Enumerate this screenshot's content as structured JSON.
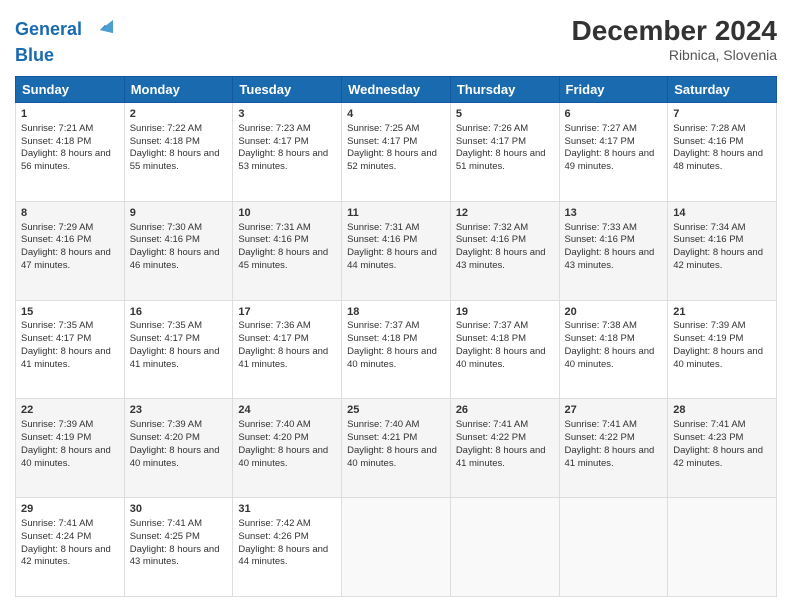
{
  "header": {
    "logo_line1": "General",
    "logo_line2": "Blue",
    "title": "December 2024",
    "subtitle": "Ribnica, Slovenia"
  },
  "days_of_week": [
    "Sunday",
    "Monday",
    "Tuesday",
    "Wednesday",
    "Thursday",
    "Friday",
    "Saturday"
  ],
  "weeks": [
    [
      {
        "day": "1",
        "sunrise": "Sunrise: 7:21 AM",
        "sunset": "Sunset: 4:18 PM",
        "daylight": "Daylight: 8 hours and 56 minutes."
      },
      {
        "day": "2",
        "sunrise": "Sunrise: 7:22 AM",
        "sunset": "Sunset: 4:18 PM",
        "daylight": "Daylight: 8 hours and 55 minutes."
      },
      {
        "day": "3",
        "sunrise": "Sunrise: 7:23 AM",
        "sunset": "Sunset: 4:17 PM",
        "daylight": "Daylight: 8 hours and 53 minutes."
      },
      {
        "day": "4",
        "sunrise": "Sunrise: 7:25 AM",
        "sunset": "Sunset: 4:17 PM",
        "daylight": "Daylight: 8 hours and 52 minutes."
      },
      {
        "day": "5",
        "sunrise": "Sunrise: 7:26 AM",
        "sunset": "Sunset: 4:17 PM",
        "daylight": "Daylight: 8 hours and 51 minutes."
      },
      {
        "day": "6",
        "sunrise": "Sunrise: 7:27 AM",
        "sunset": "Sunset: 4:17 PM",
        "daylight": "Daylight: 8 hours and 49 minutes."
      },
      {
        "day": "7",
        "sunrise": "Sunrise: 7:28 AM",
        "sunset": "Sunset: 4:16 PM",
        "daylight": "Daylight: 8 hours and 48 minutes."
      }
    ],
    [
      {
        "day": "8",
        "sunrise": "Sunrise: 7:29 AM",
        "sunset": "Sunset: 4:16 PM",
        "daylight": "Daylight: 8 hours and 47 minutes."
      },
      {
        "day": "9",
        "sunrise": "Sunrise: 7:30 AM",
        "sunset": "Sunset: 4:16 PM",
        "daylight": "Daylight: 8 hours and 46 minutes."
      },
      {
        "day": "10",
        "sunrise": "Sunrise: 7:31 AM",
        "sunset": "Sunset: 4:16 PM",
        "daylight": "Daylight: 8 hours and 45 minutes."
      },
      {
        "day": "11",
        "sunrise": "Sunrise: 7:31 AM",
        "sunset": "Sunset: 4:16 PM",
        "daylight": "Daylight: 8 hours and 44 minutes."
      },
      {
        "day": "12",
        "sunrise": "Sunrise: 7:32 AM",
        "sunset": "Sunset: 4:16 PM",
        "daylight": "Daylight: 8 hours and 43 minutes."
      },
      {
        "day": "13",
        "sunrise": "Sunrise: 7:33 AM",
        "sunset": "Sunset: 4:16 PM",
        "daylight": "Daylight: 8 hours and 43 minutes."
      },
      {
        "day": "14",
        "sunrise": "Sunrise: 7:34 AM",
        "sunset": "Sunset: 4:16 PM",
        "daylight": "Daylight: 8 hours and 42 minutes."
      }
    ],
    [
      {
        "day": "15",
        "sunrise": "Sunrise: 7:35 AM",
        "sunset": "Sunset: 4:17 PM",
        "daylight": "Daylight: 8 hours and 41 minutes."
      },
      {
        "day": "16",
        "sunrise": "Sunrise: 7:35 AM",
        "sunset": "Sunset: 4:17 PM",
        "daylight": "Daylight: 8 hours and 41 minutes."
      },
      {
        "day": "17",
        "sunrise": "Sunrise: 7:36 AM",
        "sunset": "Sunset: 4:17 PM",
        "daylight": "Daylight: 8 hours and 41 minutes."
      },
      {
        "day": "18",
        "sunrise": "Sunrise: 7:37 AM",
        "sunset": "Sunset: 4:18 PM",
        "daylight": "Daylight: 8 hours and 40 minutes."
      },
      {
        "day": "19",
        "sunrise": "Sunrise: 7:37 AM",
        "sunset": "Sunset: 4:18 PM",
        "daylight": "Daylight: 8 hours and 40 minutes."
      },
      {
        "day": "20",
        "sunrise": "Sunrise: 7:38 AM",
        "sunset": "Sunset: 4:18 PM",
        "daylight": "Daylight: 8 hours and 40 minutes."
      },
      {
        "day": "21",
        "sunrise": "Sunrise: 7:39 AM",
        "sunset": "Sunset: 4:19 PM",
        "daylight": "Daylight: 8 hours and 40 minutes."
      }
    ],
    [
      {
        "day": "22",
        "sunrise": "Sunrise: 7:39 AM",
        "sunset": "Sunset: 4:19 PM",
        "daylight": "Daylight: 8 hours and 40 minutes."
      },
      {
        "day": "23",
        "sunrise": "Sunrise: 7:39 AM",
        "sunset": "Sunset: 4:20 PM",
        "daylight": "Daylight: 8 hours and 40 minutes."
      },
      {
        "day": "24",
        "sunrise": "Sunrise: 7:40 AM",
        "sunset": "Sunset: 4:20 PM",
        "daylight": "Daylight: 8 hours and 40 minutes."
      },
      {
        "day": "25",
        "sunrise": "Sunrise: 7:40 AM",
        "sunset": "Sunset: 4:21 PM",
        "daylight": "Daylight: 8 hours and 40 minutes."
      },
      {
        "day": "26",
        "sunrise": "Sunrise: 7:41 AM",
        "sunset": "Sunset: 4:22 PM",
        "daylight": "Daylight: 8 hours and 41 minutes."
      },
      {
        "day": "27",
        "sunrise": "Sunrise: 7:41 AM",
        "sunset": "Sunset: 4:22 PM",
        "daylight": "Daylight: 8 hours and 41 minutes."
      },
      {
        "day": "28",
        "sunrise": "Sunrise: 7:41 AM",
        "sunset": "Sunset: 4:23 PM",
        "daylight": "Daylight: 8 hours and 42 minutes."
      }
    ],
    [
      {
        "day": "29",
        "sunrise": "Sunrise: 7:41 AM",
        "sunset": "Sunset: 4:24 PM",
        "daylight": "Daylight: 8 hours and 42 minutes."
      },
      {
        "day": "30",
        "sunrise": "Sunrise: 7:41 AM",
        "sunset": "Sunset: 4:25 PM",
        "daylight": "Daylight: 8 hours and 43 minutes."
      },
      {
        "day": "31",
        "sunrise": "Sunrise: 7:42 AM",
        "sunset": "Sunset: 4:26 PM",
        "daylight": "Daylight: 8 hours and 44 minutes."
      },
      null,
      null,
      null,
      null
    ]
  ]
}
